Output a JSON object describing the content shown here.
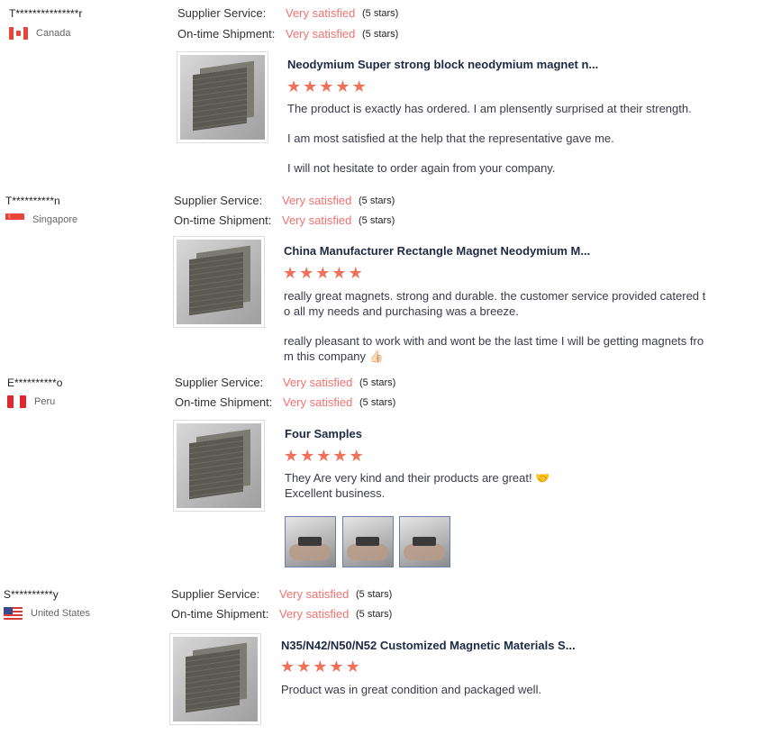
{
  "reviews": [
    {
      "buyer": "T***************r",
      "country": "Canada",
      "flag_icon": "canada-flag-icon",
      "supplier_service": {
        "label": "Supplier Service:",
        "value": "Very satisfied",
        "stars": "(5 stars)"
      },
      "shipment": {
        "label": "On-time Shipment:",
        "value": "Very satisfied",
        "stars": "(5 stars)"
      },
      "product_title": "Neodymium Super strong block neodymium magnet n...",
      "rating": 5,
      "text": [
        "The product is exactly has ordered. I am plensently surprised at their strength.",
        "I am most satisfied at the help that the representative gave me.",
        "I will not hesitate to order again from your company."
      ]
    },
    {
      "buyer": "T**********n",
      "country": "Singapore",
      "flag_icon": "singapore-flag-icon",
      "supplier_service": {
        "label": "Supplier Service:",
        "value": "Very satisfied",
        "stars": "(5 stars)"
      },
      "shipment": {
        "label": "On-time Shipment:",
        "value": "Very satisfied",
        "stars": "(5 stars)"
      },
      "product_title": "China Manufacturer Rectangle Magnet Neodymium M...",
      "rating": 5,
      "text": [
        "really great magnets. strong and durable. the customer service provided catered t o all my needs and purchasing was a breeze.",
        "really pleasant to work with and wont be the last time I will be getting magnets fro m this company 👍🏻"
      ]
    },
    {
      "buyer": "E**********o",
      "country": "Peru",
      "flag_icon": "peru-flag-icon",
      "supplier_service": {
        "label": "Supplier Service:",
        "value": "Very satisfied",
        "stars": "(5 stars)"
      },
      "shipment": {
        "label": "On-time Shipment:",
        "value": "Very satisfied",
        "stars": "(5 stars)"
      },
      "product_title": "Four Samples",
      "rating": 5,
      "text": [
        "They Are very kind  and  their products are great! 🤝 Excellent business."
      ],
      "photos": 3
    },
    {
      "buyer": "S**********y",
      "country": "United States",
      "flag_icon": "united-states-flag-icon",
      "supplier_service": {
        "label": "Supplier Service:",
        "value": "Very satisfied",
        "stars": "(5 stars)"
      },
      "shipment": {
        "label": "On-time Shipment:",
        "value": "Very satisfied",
        "stars": "(5 stars)"
      },
      "product_title": "N35/N42/N50/N52 Customized Magnetic Materials S...",
      "rating": 5,
      "text": [
        "Product was in great condition and packaged well."
      ]
    }
  ],
  "colors": {
    "accent": "#f2726f",
    "star": "#f0715a",
    "title": "#1d2a44"
  }
}
